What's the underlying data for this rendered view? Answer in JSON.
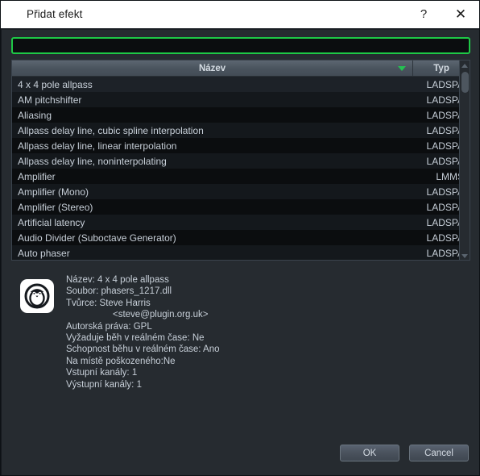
{
  "window": {
    "title": "Přidat efekt",
    "help_label": "?",
    "close_label": "✕"
  },
  "search": {
    "value": "",
    "placeholder": ""
  },
  "table": {
    "columns": [
      {
        "key": "name",
        "label": "Název",
        "sorted": true,
        "sort_direction": "desc"
      },
      {
        "key": "type",
        "label": "Typ",
        "sorted": false
      }
    ],
    "rows": [
      {
        "name": "4 x 4 pole allpass",
        "type": "LADSPA",
        "selected": true
      },
      {
        "name": "AM pitchshifter",
        "type": "LADSPA",
        "selected": false
      },
      {
        "name": "Aliasing",
        "type": "LADSPA",
        "selected": false
      },
      {
        "name": "Allpass delay line, cubic spline interpolation",
        "type": "LADSPA",
        "selected": false
      },
      {
        "name": "Allpass delay line, linear interpolation",
        "type": "LADSPA",
        "selected": false
      },
      {
        "name": "Allpass delay line, noninterpolating",
        "type": "LADSPA",
        "selected": false
      },
      {
        "name": "Amplifier",
        "type": "LMMS",
        "selected": false
      },
      {
        "name": "Amplifier (Mono)",
        "type": "LADSPA",
        "selected": false
      },
      {
        "name": "Amplifier (Stereo)",
        "type": "LADSPA",
        "selected": false
      },
      {
        "name": "Artificial latency",
        "type": "LADSPA",
        "selected": false
      },
      {
        "name": "Audio Divider (Suboctave Generator)",
        "type": "LADSPA",
        "selected": false
      },
      {
        "name": "Auto phaser",
        "type": "LADSPA",
        "selected": false
      }
    ]
  },
  "scrollbar": {
    "up_arrow": "scroll-up-arrow",
    "down_arrow": "scroll-down-arrow"
  },
  "info": {
    "icon": "penguin-icon",
    "lines": [
      "Název: 4 x 4 pole allpass",
      "Soubor: phasers_1217.dll",
      "Tvůrce: Steve Harris",
      "<steve@plugin.org.uk>",
      "Autorská práva: GPL",
      "Vyžaduje běh v reálném čase: Ne",
      "Schopnost běhu v reálném čase: Ano",
      "Na místě poškozeného:Ne",
      "Vstupní kanály: 1",
      "Výstupní kanály: 1"
    ]
  },
  "footer": {
    "ok_label": "OK",
    "cancel_label": "Cancel"
  },
  "colors": {
    "accent_green": "#1ec846",
    "sort_arrow_green": "#25c152",
    "window_bg": "#262b30",
    "list_bg": "#0b0d0f",
    "titlebar_bg": "#ffffff",
    "text": "#c7cfd8"
  }
}
